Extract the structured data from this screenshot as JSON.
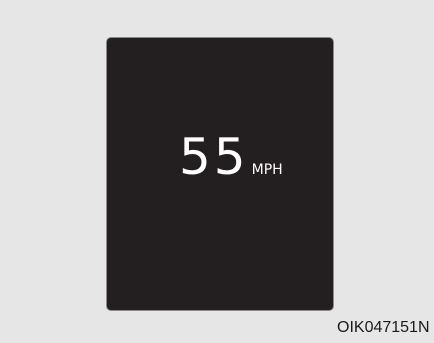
{
  "display": {
    "speed_value": "55",
    "speed_unit": "MPH"
  },
  "figure_code": "OIK047151N",
  "colors": {
    "page_background": "#e6e6e6",
    "display_background": "#231f20",
    "display_text": "#ffffff"
  }
}
